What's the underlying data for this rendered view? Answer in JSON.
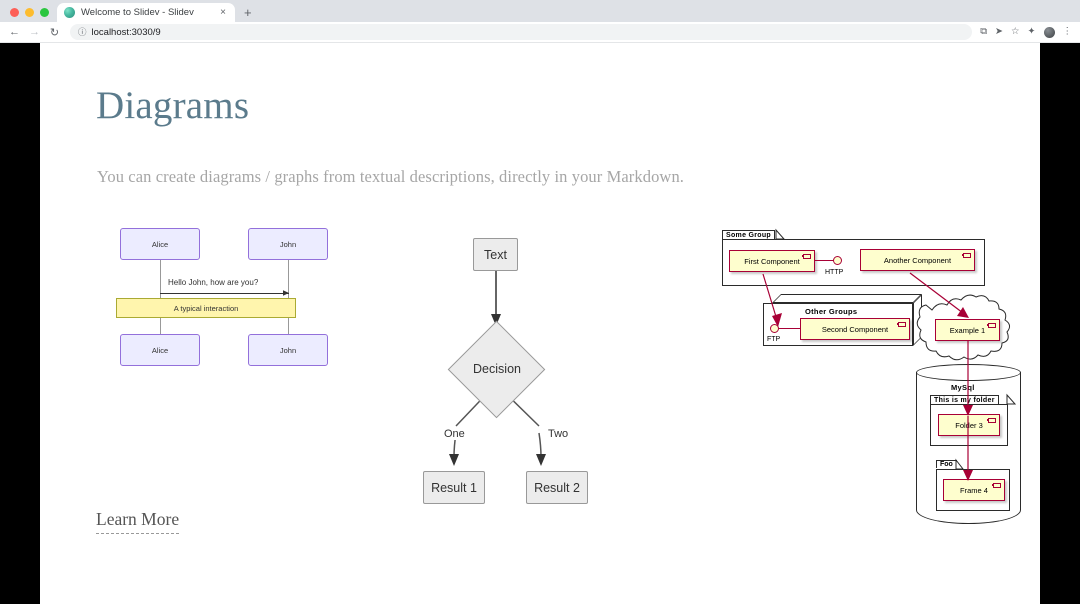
{
  "browser": {
    "tab": {
      "title": "Welcome to Slidev - Slidev",
      "favicon": "slidev-logo-icon",
      "close": "×"
    },
    "new_tab_label": "+",
    "nav": {
      "back": "←",
      "forward": "→",
      "reload": "↻"
    },
    "omnibox": {
      "info_icon": "ⓘ",
      "url": "localhost:3030/9"
    },
    "actions": {
      "translate": "⧉",
      "send": "➤",
      "bookmark": "☆",
      "extensions": "✦",
      "avatar": "avatar-icon",
      "menu": "⋮"
    },
    "window_controls": {
      "close": "close",
      "minimize": "minimize",
      "maximize": "maximize"
    }
  },
  "slide": {
    "title": "Diagrams",
    "subtitle": "You can create diagrams / graphs from textual descriptions, directly in your Markdown.",
    "learn_more": "Learn More"
  },
  "sequence_diagram": {
    "actor_left_top": "Alice",
    "actor_right_top": "John",
    "actor_left_bottom": "Alice",
    "actor_right_bottom": "John",
    "message": "Hello John, how are you?",
    "note": "A typical interaction",
    "colors": {
      "actor_fill": "#ECECFF",
      "actor_border": "#9370DB",
      "note_fill": "#fff5ad",
      "note_border": "#aaaa33"
    }
  },
  "flowchart": {
    "start": "Text",
    "decision": "Decision",
    "edge_left": "One",
    "edge_right": "Two",
    "result_left": "Result 1",
    "result_right": "Result 2",
    "colors": {
      "node_fill": "#ECECEC",
      "node_border": "#999999",
      "arrow": "#333333"
    }
  },
  "plantuml": {
    "group_some": "Some Group",
    "first_component": "First Component",
    "another_component": "Another Component",
    "http_interface": "HTTP",
    "other_groups": "Other Groups",
    "second_component": "Second Component",
    "ftp_interface": "FTP",
    "example_cloud": "Example 1",
    "database": "MySql",
    "folder": "This is my folder",
    "folder_component": "Folder 3",
    "frame": "Foo",
    "frame_component": "Frame 4",
    "colors": {
      "fill": "#FEFECE",
      "border": "#A80036",
      "outline": "#2b2b2b"
    }
  }
}
